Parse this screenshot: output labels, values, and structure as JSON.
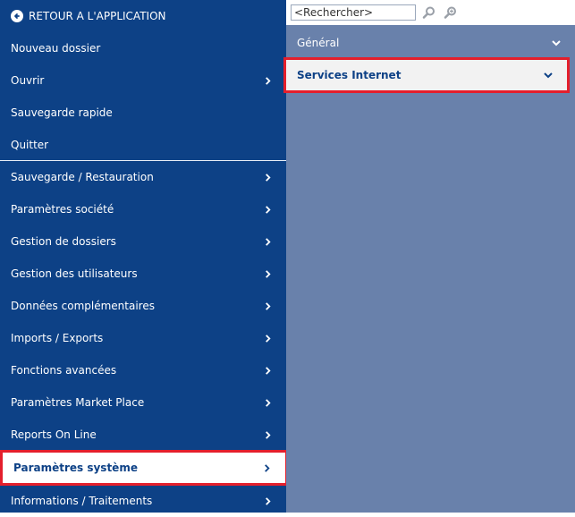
{
  "sidebar": {
    "back_label": "RETOUR A L'APPLICATION",
    "items": [
      {
        "label": "Nouveau dossier",
        "chevron": false
      },
      {
        "label": "Ouvrir",
        "chevron": true
      },
      {
        "label": "Sauvegarde rapide",
        "chevron": false
      },
      {
        "label": "Quitter",
        "chevron": false
      },
      {
        "label": "Sauvegarde / Restauration",
        "chevron": true
      },
      {
        "label": "Paramètres société",
        "chevron": true
      },
      {
        "label": "Gestion de dossiers",
        "chevron": true
      },
      {
        "label": "Gestion des utilisateurs",
        "chevron": true
      },
      {
        "label": "Données complémentaires",
        "chevron": true
      },
      {
        "label": "Imports / Exports",
        "chevron": true
      },
      {
        "label": "Fonctions avancées",
        "chevron": true
      },
      {
        "label": "Paramètres Market Place",
        "chevron": true
      },
      {
        "label": "Reports On Line",
        "chevron": true
      },
      {
        "label": "Paramètres système",
        "chevron": true,
        "selected": true
      },
      {
        "label": "Informations / Traitements",
        "chevron": true
      }
    ]
  },
  "panel": {
    "search": {
      "value": "<Rechercher>"
    },
    "items": [
      {
        "label": "Général"
      },
      {
        "label": "Services Internet",
        "selected": true
      }
    ]
  },
  "colors": {
    "sidebar_bg": "#0d4186",
    "panel_bg": "#6981ab",
    "highlight_border": "#e41f2c"
  },
  "icons": {
    "back": "arrow-left-circle-icon",
    "search": "search-icon",
    "search_next": "search-next-icon",
    "chevron_right": "chevron-right-icon",
    "chevron_down": "chevron-down-icon"
  }
}
